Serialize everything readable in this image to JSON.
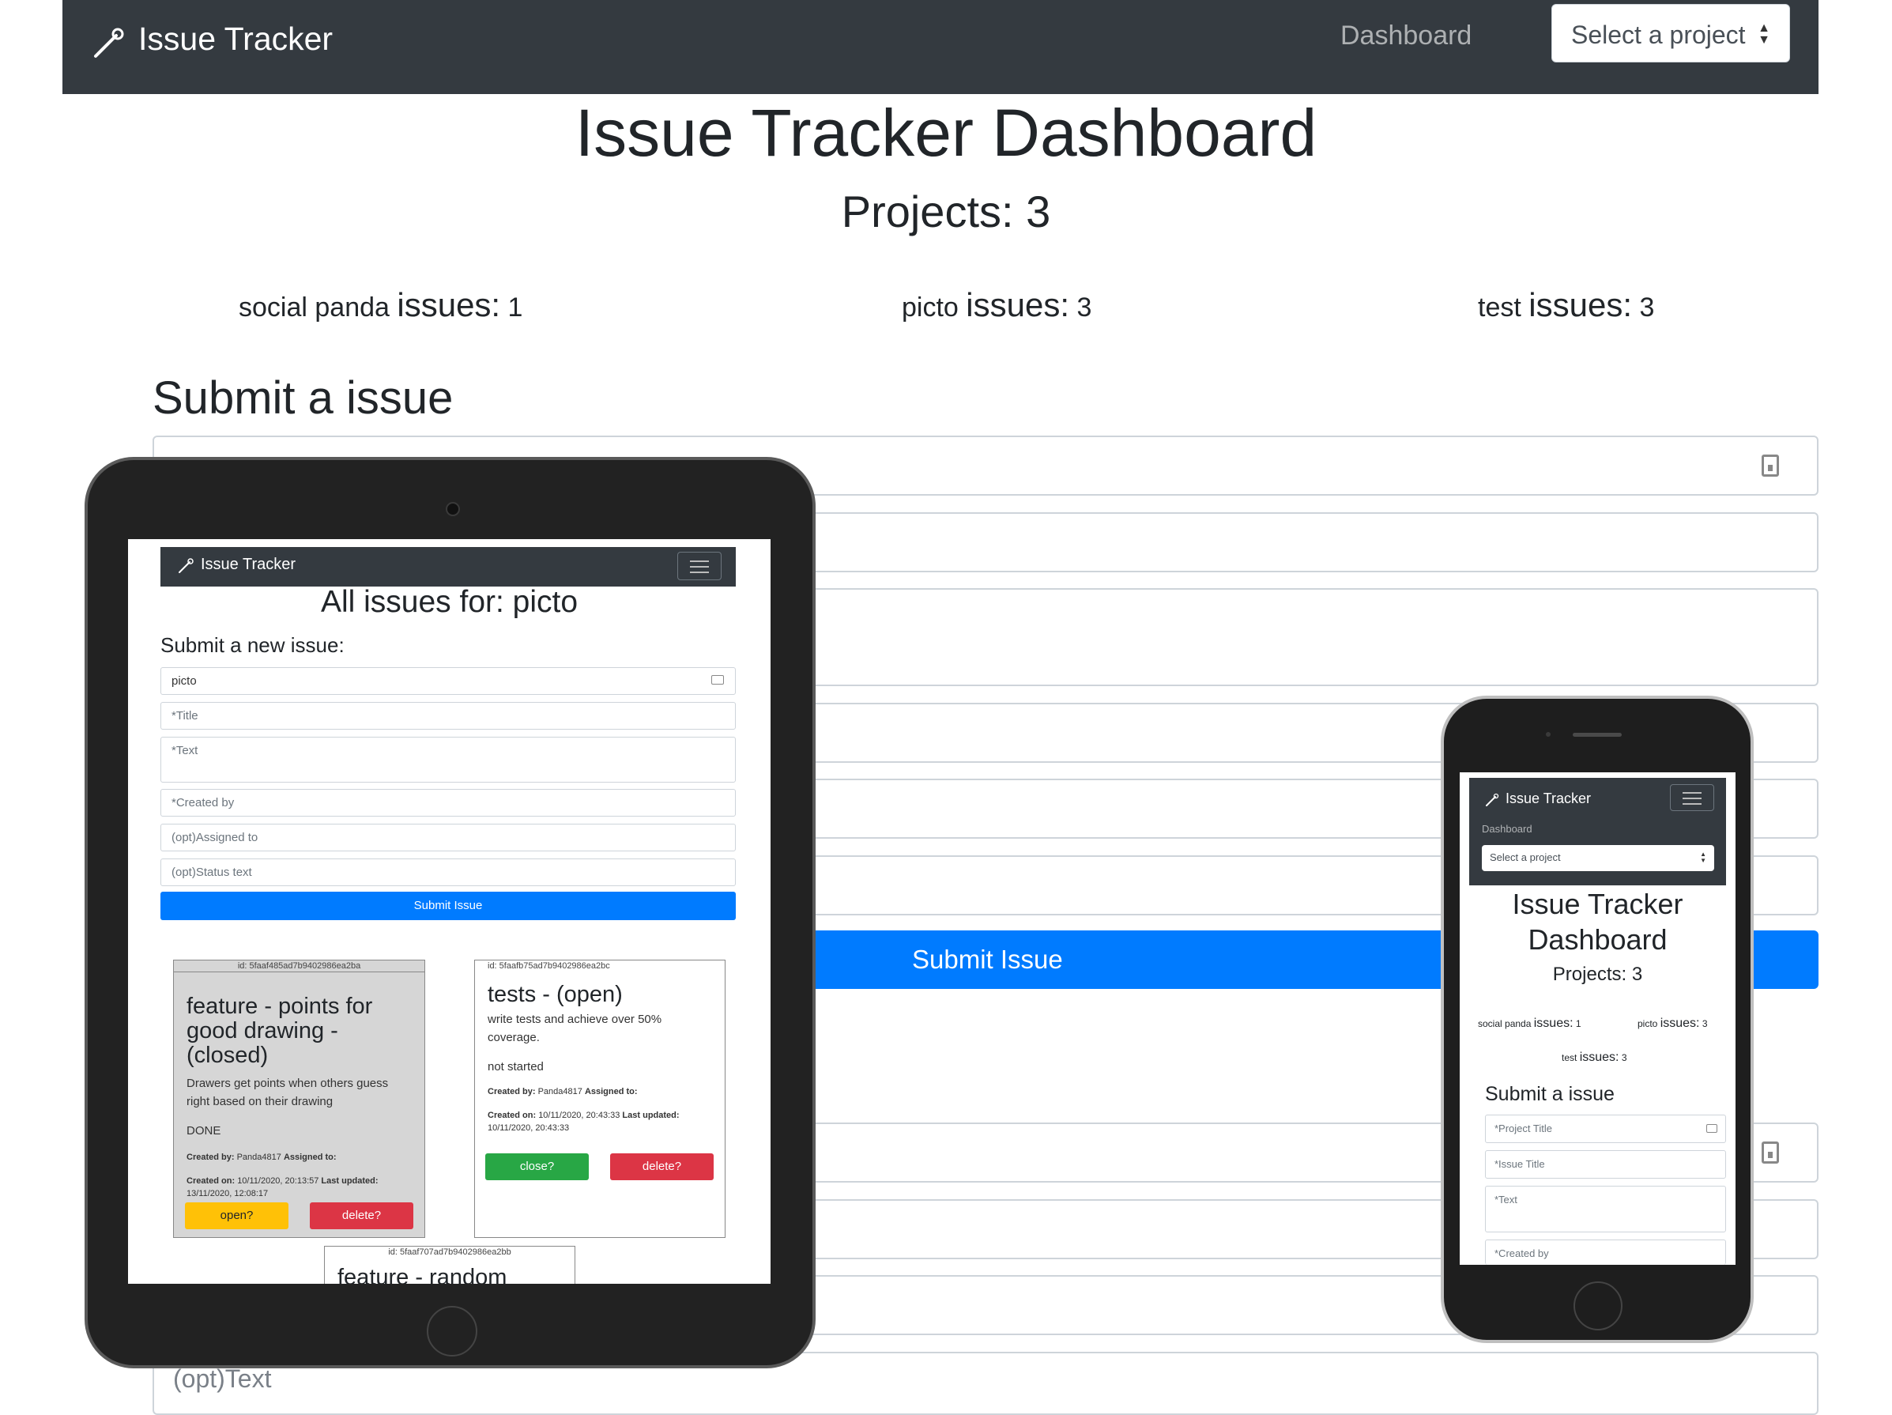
{
  "navbar": {
    "brand": "Issue Tracker",
    "dashboard_link": "Dashboard",
    "project_select": "Select a project"
  },
  "page": {
    "title": "Issue Tracker Dashboard",
    "projects_count": "Projects: 3",
    "projects": [
      {
        "name": "social panda",
        "issues_label": "issues:",
        "count": "1"
      },
      {
        "name": "picto",
        "issues_label": "issues:",
        "count": "3"
      },
      {
        "name": "test",
        "issues_label": "issues:",
        "count": "3"
      }
    ],
    "submit_heading": "Submit a issue",
    "field_bottom_placeholder": "(opt)Text",
    "submit_button": "Submit Issue"
  },
  "tablet": {
    "brand": "Issue Tracker",
    "title": "All issues for: picto",
    "subtitle": "Submit a new issue:",
    "fields": [
      "picto",
      "*Title",
      "*Text",
      "*Created by",
      "(opt)Assigned to",
      "(opt)Status text"
    ],
    "submit_button": "Submit Issue",
    "cards": [
      {
        "id": "id: 5faaf485ad7b9402986ea2ba",
        "title": "feature - points for good drawing - (closed)",
        "text": "Drawers get points when others guess right based on their drawing",
        "status": "DONE",
        "created_by_label": "Created by:",
        "created_by": "Panda4817",
        "assigned_label": "Assigned to:",
        "created_on_label": "Created on:",
        "created_on": "10/11/2020, 20:13:57",
        "updated_label": "Last updated:",
        "updated": "13/11/2020, 12:08:17",
        "action_button": "open?",
        "delete_button": "delete?"
      },
      {
        "id": "id: 5faafb75ad7b9402986ea2bc",
        "title": "tests - (open)",
        "text": "write tests and achieve over 50% coverage.",
        "status": "not started",
        "created_by_label": "Created by:",
        "created_by": "Panda4817",
        "assigned_label": "Assigned to:",
        "created_on_label": "Created on:",
        "created_on": "10/11/2020, 20:43:33",
        "updated_label": "Last updated:",
        "updated": "10/11/2020, 20:43:33",
        "action_button": "close?",
        "delete_button": "delete?"
      },
      {
        "id": "id: 5faaf707ad7b9402986ea2bb",
        "title": "feature - random"
      }
    ]
  },
  "phone": {
    "brand": "Issue Tracker",
    "dashboard_link": "Dashboard",
    "project_select": "Select a project",
    "title_line1": "Issue Tracker",
    "title_line2": "Dashboard",
    "projects_count": "Projects: 3",
    "projects": [
      {
        "name": "social panda",
        "issues_label": "issues:",
        "count": "1"
      },
      {
        "name": "picto",
        "issues_label": "issues:",
        "count": "3"
      },
      {
        "name": "test",
        "issues_label": "issues:",
        "count": "3"
      }
    ],
    "submit_heading": "Submit a issue",
    "fields": [
      "*Project Title",
      "*Issue Title",
      "*Text",
      "*Created by"
    ]
  },
  "colors": {
    "navbar": "#343a40",
    "primary": "#007bff",
    "success": "#28a745",
    "warning": "#ffc107",
    "danger": "#dc3545"
  }
}
